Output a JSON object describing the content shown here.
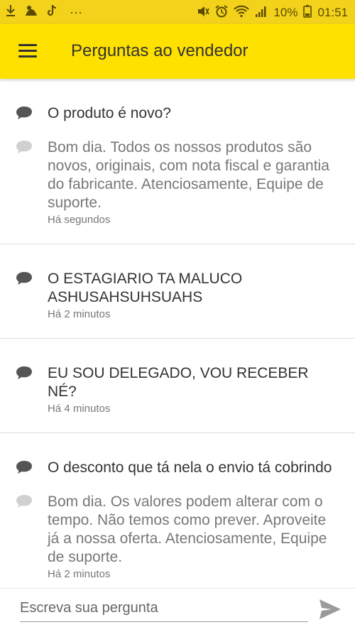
{
  "status_bar": {
    "battery": "10%",
    "time": "01:51",
    "dots": "···"
  },
  "header": {
    "title": "Perguntas ao vendedor"
  },
  "questions": [
    {
      "question": "O produto é novo?",
      "answer": "Bom dia. Todos os nossos produtos são novos, originais, com nota fiscal e garantia do fabricante. Atenciosamente, Equipe de suporte.",
      "answer_time": "Há segundos"
    },
    {
      "question": "O ESTAGIARIO TA MALUCO ASHUSAHSUHSUAHS",
      "time": "Há 2 minutos"
    },
    {
      "question": "EU SOU DELEGADO, VOU RECEBER NÉ?",
      "time": "Há 4 minutos"
    },
    {
      "question": "O desconto que tá nela o envio tá cobrindo",
      "answer": "Bom dia. Os valores podem alterar com o tempo. Não temos como prever. Aproveite já a nossa oferta. Atenciosamente, Equipe de suporte.",
      "answer_time": "Há 2 minutos"
    }
  ],
  "composer": {
    "placeholder": "Escreva sua pergunta"
  }
}
